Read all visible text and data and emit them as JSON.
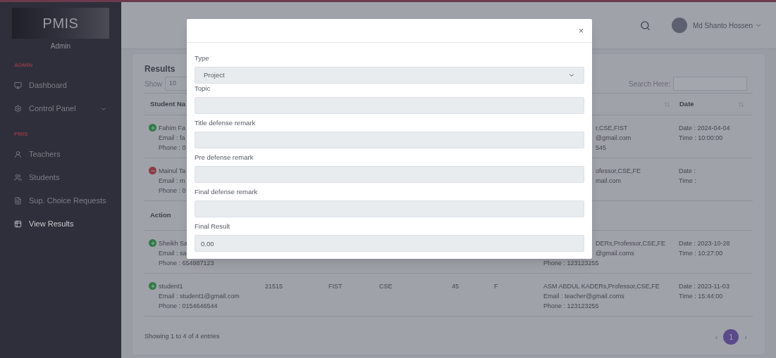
{
  "sidebar": {
    "logo": "PMIS",
    "role": "Admin",
    "sections": [
      {
        "title": "ADMIN",
        "items": [
          {
            "label": "Dashboard",
            "selected": false,
            "has_submenu": false
          },
          {
            "label": "Control Panel",
            "selected": false,
            "has_submenu": true
          }
        ]
      },
      {
        "title": "PMIS",
        "items": [
          {
            "label": "Teachers",
            "selected": false,
            "has_submenu": false
          },
          {
            "label": "Students",
            "selected": false,
            "has_submenu": false
          },
          {
            "label": "Sup. Choice Requests",
            "selected": false,
            "has_submenu": false
          },
          {
            "label": "View Results",
            "selected": true,
            "has_submenu": false
          }
        ]
      }
    ]
  },
  "topbar": {
    "user_name": "Md Shanto Hossen"
  },
  "results": {
    "title": "Results",
    "show_label": "Show",
    "page_size": "10",
    "search_label": "Search Here:",
    "header": {
      "student": "Student Na",
      "date": "Date"
    },
    "rows": [
      {
        "expanded": false,
        "student": [
          "Fahim Fa",
          "Email : fa",
          "Phone : 0"
        ],
        "cells": [],
        "supervisor": [
          {
            "text": "r,CSE,FIST",
            "kind": "tail"
          },
          {
            "text": "@gmail.com",
            "kind": "tail"
          },
          {
            "text": "545",
            "kind": "tail"
          }
        ],
        "date": [
          "Date : 2024-04-04",
          "Time : 10:00:00"
        ]
      },
      {
        "expanded": true,
        "student": [
          "Mainul Ta",
          "Email : m",
          "Phone : 0"
        ],
        "cells": [],
        "supervisor": [
          {
            "text": "ofessor,CSE,FE",
            "kind": "tail"
          },
          {
            "text": "mail.com",
            "kind": "tail"
          }
        ],
        "date": [
          "Date :",
          "Time :"
        ],
        "details": {
          "label": "Action"
        }
      },
      {
        "expanded": false,
        "student": [
          "Sheikh Sa",
          "Email : sa",
          "Phone : 654987123"
        ],
        "cells": [],
        "supervisor": [
          {
            "text": "DERs,Professor,CSE,FE",
            "kind": "tail"
          },
          {
            "text": "@gmail.coms",
            "kind": "tail"
          },
          {
            "text": "Phone : 123123255",
            "kind": "full"
          }
        ],
        "date": [
          "Date : 2023-10-28",
          "Time : 10:27:00"
        ]
      },
      {
        "expanded": false,
        "student": [
          "student1",
          "Email : student1@gmail.com",
          "Phone : 0154646544"
        ],
        "cells": [
          "21515",
          "FIST",
          "CSE",
          "45",
          "F"
        ],
        "supervisor": [
          {
            "text": "ASM ABDUL KADERs,Professor,CSE,FE",
            "kind": "full"
          },
          {
            "text": "Email : teacher@gmail.coms",
            "kind": "full"
          },
          {
            "text": "Phone : 123123255",
            "kind": "full"
          }
        ],
        "date": [
          "Date : 2023-11-03",
          "Time : 15:44:00"
        ]
      }
    ],
    "footer": "Showing 1 to 4 of 4 entries",
    "pages": [
      {
        "label": "1",
        "selected": true
      }
    ],
    "prev": "‹",
    "next": "›"
  },
  "modal": {
    "close": "×",
    "fields": [
      {
        "label": "Type",
        "kind": "select",
        "value": "Project"
      },
      {
        "label": "Topic",
        "kind": "input"
      },
      {
        "label": "Title defense remark",
        "kind": "input"
      },
      {
        "label": "Pre defense remark",
        "kind": "input"
      },
      {
        "label": "Final defense remark",
        "kind": "input"
      },
      {
        "label": "Final Result",
        "kind": "input",
        "value": "0.00"
      }
    ]
  }
}
